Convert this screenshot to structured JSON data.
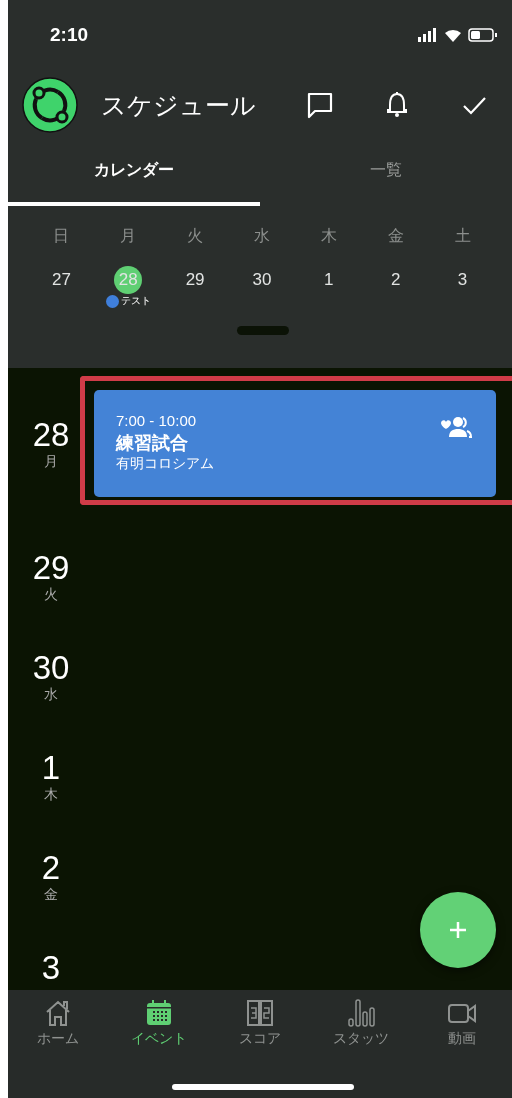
{
  "status_bar": {
    "time": "2:10"
  },
  "header": {
    "title": "スケジュール"
  },
  "tabs": [
    {
      "label": "カレンダー",
      "selected": true
    },
    {
      "label": "一覧",
      "selected": false
    }
  ],
  "week": {
    "weekdays": [
      "日",
      "月",
      "火",
      "水",
      "木",
      "金",
      "土"
    ],
    "days": [
      {
        "date": "27",
        "selected": false
      },
      {
        "date": "28",
        "selected": true,
        "events": [
          {
            "title": "テスト",
            "color": "#3f7fdb"
          }
        ]
      },
      {
        "date": "29",
        "selected": false
      },
      {
        "date": "30",
        "selected": false
      },
      {
        "date": "1",
        "selected": false
      },
      {
        "date": "2",
        "selected": false
      },
      {
        "date": "3",
        "selected": false
      }
    ]
  },
  "agenda": [
    {
      "date": "28",
      "weekday": "月",
      "events": [
        {
          "time": "7:00 - 10:00",
          "title": "練習試合",
          "place": "有明コロシアム",
          "color": "#4483d6",
          "highlighted": true
        }
      ]
    },
    {
      "date": "29",
      "weekday": "火"
    },
    {
      "date": "30",
      "weekday": "水"
    },
    {
      "date": "1",
      "weekday": "木"
    },
    {
      "date": "2",
      "weekday": "金"
    },
    {
      "date": "3"
    }
  ],
  "bottom_nav": [
    {
      "label": "ホーム",
      "selected": false
    },
    {
      "label": "イベント",
      "selected": true
    },
    {
      "label": "スコア",
      "selected": false
    },
    {
      "label": "スタッツ",
      "selected": false
    },
    {
      "label": "動画",
      "selected": false
    }
  ]
}
